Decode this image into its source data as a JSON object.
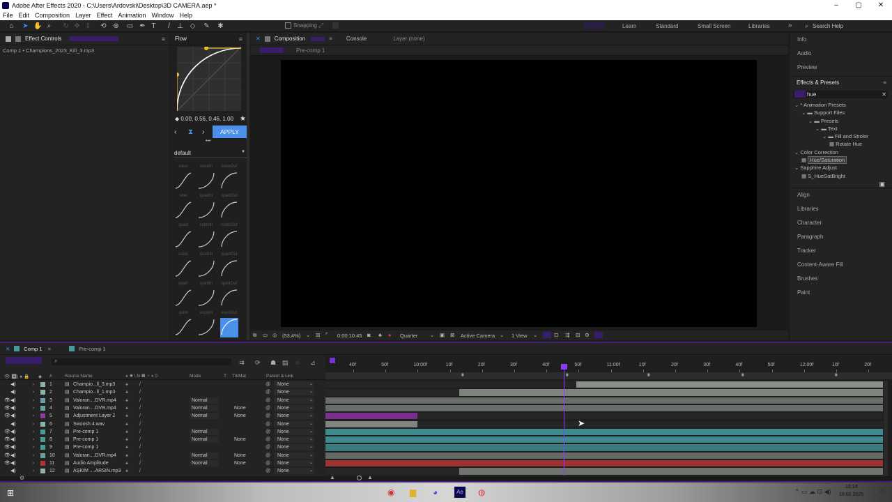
{
  "window": {
    "title": "Adobe After Effects 2020 - C:\\Users\\Ardovski\\Desktop\\3D CAMERA.aep *",
    "min": "–",
    "max": "▢",
    "close": "✕"
  },
  "menu": [
    "File",
    "Edit",
    "Composition",
    "Layer",
    "Effect",
    "Animation",
    "Window",
    "Help"
  ],
  "toolbar": {
    "snapping": "Snapping",
    "workspaces": [
      "Learn",
      "Standard",
      "Small Screen",
      "Libraries"
    ],
    "search": "Search Help",
    "expand": "»"
  },
  "effect_controls": {
    "tab": "Effect Controls",
    "subtitle": "Comp 1 • Champions_2023_Kill_3.mp3"
  },
  "flow": {
    "tab": "Flow",
    "values": "0.00, 0.56, 0.46, 1.00",
    "apply": "APPLY",
    "preset": "default",
    "more": "•••",
    "rows": [
      [
        "ease",
        "easeIn",
        "easeOut"
      ],
      [
        "sine",
        "quadIn",
        "quadOut"
      ],
      [
        "quad",
        "cubicIn",
        "cubicOut"
      ],
      [
        "cubic",
        "quartIn",
        "quartOut"
      ],
      [
        "quart",
        "quintIn",
        "quintOut"
      ],
      [
        "quint",
        "expoIn",
        "expoOut"
      ]
    ]
  },
  "composition": {
    "tab": "Composition",
    "console": "Console",
    "layer": "Layer (none)",
    "subtab": "Pre-comp 1",
    "footer": {
      "zoom": "(53,4%)",
      "timecode": "0:00:10:45",
      "quality": "Quarter",
      "camera": "Active Camera",
      "views": "1 View"
    }
  },
  "right_panel": {
    "top": [
      "Info",
      "Audio",
      "Preview"
    ],
    "effects_title": "Effects & Presets",
    "search": "hue",
    "tree": [
      {
        "label": "* Animation Presets",
        "indent": 0
      },
      {
        "label": "Support Files",
        "indent": 1
      },
      {
        "label": "Presets",
        "indent": 2
      },
      {
        "label": "Text",
        "indent": 3
      },
      {
        "label": "Fill and Stroke",
        "indent": 4
      },
      {
        "label": "Rotate Hue",
        "indent": 5
      },
      {
        "label": "Color Correction",
        "indent": 0
      },
      {
        "label": "Hue/Saturation",
        "indent": 1
      },
      {
        "label": "Sapphire Adjust",
        "indent": 0
      },
      {
        "label": "S_HueSatBright",
        "indent": 1
      }
    ],
    "bottom": [
      "Align",
      "Libraries",
      "Character",
      "Paragraph",
      "Tracker",
      "Content-Aware Fill",
      "Brushes",
      "Paint"
    ]
  },
  "timeline": {
    "tabs": [
      "Comp 1",
      "Pre-comp 1"
    ],
    "headers": {
      "num": "#",
      "source": "Source Name",
      "mode": "Mode",
      "t": "T",
      "trkmat": "TrkMat",
      "parent": "Parent & Link"
    },
    "ruler": [
      "40f",
      "50f",
      "10:00f",
      "10f",
      "20f",
      "30f",
      "40f",
      "50f",
      "11:00f",
      "10f",
      "20f",
      "30f",
      "40f",
      "50f",
      "12:00f",
      "10f",
      "20f"
    ],
    "layers": [
      {
        "n": "1",
        "name": "Champio...ll_3.mp3",
        "color": "#8fb3a6",
        "mode": "",
        "trk": "",
        "parent": "None",
        "bar_start": 0.45,
        "bar_end": 1.0,
        "bar_color": "#8a8f8a"
      },
      {
        "n": "2",
        "name": "Champio...ll_1.mp3",
        "color": "#8fb3a6",
        "mode": "",
        "trk": "",
        "parent": "None",
        "bar_start": 0.24,
        "bar_end": 1.0,
        "bar_color": "#7d837d"
      },
      {
        "n": "3",
        "name": "Valoran....DVR.mp4",
        "color": "#6b9fa0",
        "mode": "Normal",
        "trk": "",
        "parent": "None",
        "bar_start": 0.0,
        "bar_end": 1.0,
        "bar_color": "#6a6e6a"
      },
      {
        "n": "4",
        "name": "Valoran....DVR.mp4",
        "color": "#6b9fa0",
        "mode": "Normal",
        "trk": "None",
        "parent": "None",
        "bar_start": 0.0,
        "bar_end": 1.0,
        "bar_color": "#6a6e6a"
      },
      {
        "n": "5",
        "name": "Adjustment Layer 2",
        "color": "#8a3aa0",
        "mode": "Normal",
        "trk": "None",
        "parent": "None",
        "bar_start": 0.0,
        "bar_end": 0.165,
        "bar_color": "#7a2f8c"
      },
      {
        "n": "6",
        "name": "Swoosh 4.wav",
        "color": "#8fb3a6",
        "mode": "",
        "trk": "",
        "parent": "None",
        "bar_start": 0.0,
        "bar_end": 0.165,
        "bar_color": "#808580"
      },
      {
        "n": "7",
        "name": "Pre-comp 1",
        "color": "#4a9a9c",
        "mode": "Normal",
        "trk": "",
        "parent": "None",
        "bar_start": 0.0,
        "bar_end": 1.0,
        "bar_color": "#3f8a8c"
      },
      {
        "n": "8",
        "name": "Pre-comp 1",
        "color": "#4a9a9c",
        "mode": "Normal",
        "trk": "None",
        "parent": "None",
        "bar_start": 0.0,
        "bar_end": 1.0,
        "bar_color": "#3f8a8c"
      },
      {
        "n": "9",
        "name": "Pre-comp 1",
        "color": "#4a9a9c",
        "mode": "",
        "trk": "",
        "parent": "None",
        "bar_start": 0.0,
        "bar_end": 1.0,
        "bar_color": "#3a7c7e"
      },
      {
        "n": "10",
        "name": "Valoran....DVR.mp4",
        "color": "#6b9fa0",
        "mode": "Normal",
        "trk": "None",
        "parent": "None",
        "bar_start": 0.0,
        "bar_end": 1.0,
        "bar_color": "#666a66"
      },
      {
        "n": "11",
        "name": "Audio Amplitude",
        "color": "#b03535",
        "mode": "Normal",
        "trk": "None",
        "parent": "None",
        "bar_start": 0.0,
        "bar_end": 1.0,
        "bar_color": "#9c3232"
      },
      {
        "n": "12",
        "name": "AŞKIM ....ARSIN.mp3",
        "color": "#8fb3a6",
        "mode": "",
        "trk": "",
        "parent": "None",
        "bar_start": 0.24,
        "bar_end": 1.0,
        "bar_color": "#6f746f"
      }
    ],
    "playhead_fraction": 0.429
  },
  "taskbar": {
    "clock": "18:14",
    "date": "18.02.2025"
  },
  "colors": {
    "accent": "#2d8cff",
    "highlight": "#8d3cff",
    "apply": "#4a90e8"
  }
}
